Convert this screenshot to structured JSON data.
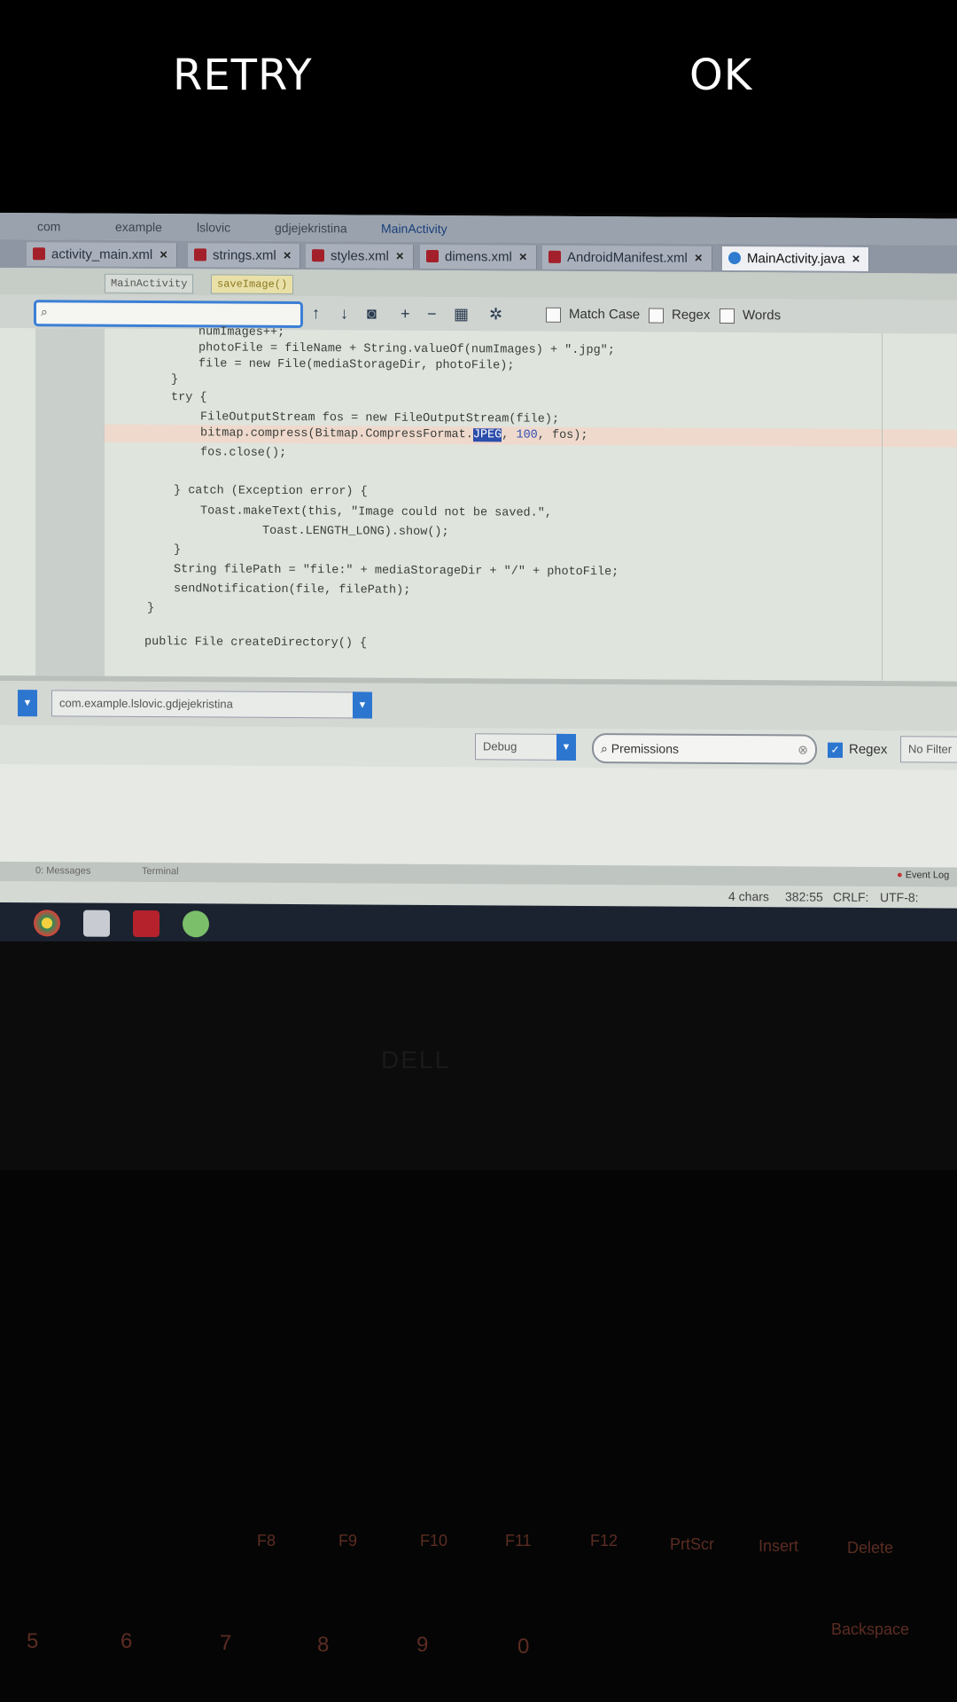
{
  "dialog": {
    "retry_label": "RETRY",
    "ok_label": "OK"
  },
  "ide": {
    "breadcrumb": [
      "com",
      "example",
      "lslovic",
      "gdjejekristina",
      "MainActivity"
    ],
    "tabs": [
      "activity_main.xml",
      "strings.xml",
      "styles.xml",
      "dimens.xml",
      "AndroidManifest.xml",
      "MainActivity.java"
    ],
    "nav": {
      "class_chip": "MainActivity",
      "method_chip": "saveImage()"
    },
    "find": {
      "match_case": "Match Case",
      "regex": "Regex",
      "words": "Words"
    },
    "code": [
      "numImages++;",
      "photoFile = fileName + String.valueOf(numImages) + \".jpg\";",
      "file = new File(mediaStorageDir, photoFile);",
      "}",
      "try {",
      "FileOutputStream fos = new FileOutputStream(file);",
      "bitmap.compress(Bitmap.CompressFormat.",
      "JPEG",
      ", ",
      "100",
      ", fos);",
      "fos.close();",
      "} catch (Exception error) {",
      "Toast.makeText(this, \"Image could not be saved.\",",
      "Toast.LENGTH_LONG).show();",
      "}",
      "String filePath = \"file:\" + mediaStorageDir + \"/\" + photoFile;",
      "sendNotification(file, filePath);",
      "}",
      "public File createDirectory() {"
    ],
    "logcat": {
      "process": "com.example.lslovic.gdjejekristina",
      "level": "Debug",
      "search": "Premissions",
      "regex_label": "Regex",
      "filter": "No Filter"
    },
    "toolwindows": [
      "0: Messages",
      "Terminal"
    ],
    "event_log": "Event Log",
    "status": {
      "chars": "4 chars",
      "position": "382:55",
      "line_sep": "CRLF:",
      "encoding": "UTF-8:"
    }
  },
  "laptop": {
    "brand": "DELL",
    "keys": [
      "F8",
      "F9",
      "F10",
      "F11",
      "F12",
      "PrtScr",
      "Insert",
      "Delete",
      "Backspace",
      "5",
      "6",
      "7",
      "8",
      "9",
      "0"
    ]
  }
}
